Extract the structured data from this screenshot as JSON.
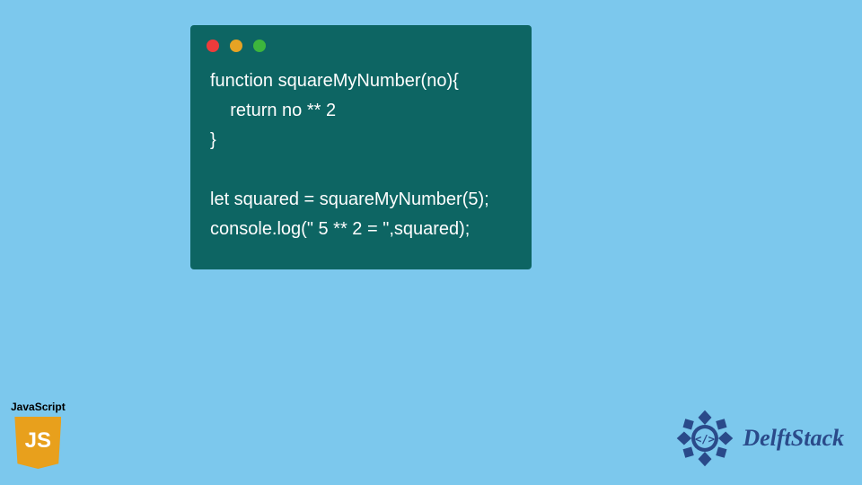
{
  "code": {
    "lines": [
      "function squareMyNumber(no){",
      "    return no ** 2",
      "}",
      "",
      "let squared = squareMyNumber(5);",
      "console.log(\" 5 ** 2 = \",squared);"
    ]
  },
  "js_badge": {
    "label": "JavaScript",
    "logo_text": "JS"
  },
  "brand": {
    "name": "DelftStack"
  },
  "colors": {
    "background": "#7cc8ed",
    "code_bg": "#0d6563",
    "code_text": "#fdfdfd",
    "js_orange": "#e8a01c",
    "brand_blue": "#2a4a8a"
  }
}
